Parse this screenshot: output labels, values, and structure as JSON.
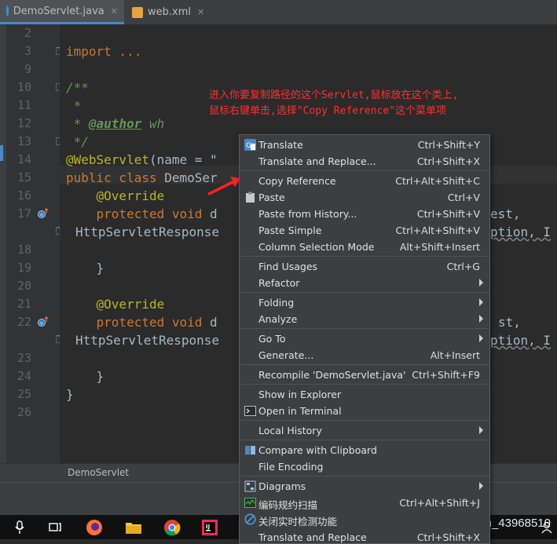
{
  "tabs": [
    {
      "label": "DemoServlet.java",
      "active": true,
      "icon": "java-class-icon"
    },
    {
      "label": "web.xml",
      "active": false,
      "icon": "xml-file-icon"
    }
  ],
  "gutter": {
    "line_numbers": [
      "2",
      "3",
      "9",
      "10",
      "11",
      "12",
      "13",
      "14",
      "15",
      "16",
      "17",
      "",
      "18",
      "19",
      "20",
      "21",
      "22",
      "",
      "23",
      "24",
      "25",
      "26"
    ]
  },
  "code": {
    "l3": "import ...",
    "l10": "/**",
    "l11": " *",
    "l12_star": " * ",
    "l12_tag": "@author",
    "l12_rest": " wh",
    "l13": " */",
    "l14_ann": "@WebServlet",
    "l14_rest": "(name = \"",
    "l15_kw": "public class ",
    "l15_rest": "DemoSer",
    "l16": "    @Override",
    "l17_kw": "    protected void ",
    "l17_rest": "d",
    "l17_right": "est,",
    "l17b": "HttpServletResponse",
    "l17b_right": "ption, I",
    "l19": "    }",
    "l21": "    @Override",
    "l22_kw": "    protected void ",
    "l22_rest": "d",
    "l22_right": "st,",
    "l22b": "HttpServletResponse",
    "l22b_right": "ption, I",
    "l24": "    }",
    "l25": "}"
  },
  "annotation_note": "进入你要复制路径的这个Servlet,鼠标放在这个类上,\n鼠标右键单击,选择\"Copy Reference\"这个菜单项",
  "breadcrumb": "DemoServlet",
  "watermark": "https://blog.csdn.net/weixin_43968510",
  "menu": {
    "items": [
      {
        "label": "Translate",
        "shortcut": "Ctrl+Shift+Y",
        "icon": "translate-icon"
      },
      {
        "label": "Translate and Replace...",
        "shortcut": "Ctrl+Shift+X"
      },
      {
        "label": "Copy Reference",
        "shortcut": "Ctrl+Alt+Shift+C"
      },
      {
        "label": "Paste",
        "shortcut": "Ctrl+V",
        "icon": "clipboard-icon"
      },
      {
        "label": "Paste from History...",
        "shortcut": "Ctrl+Shift+V"
      },
      {
        "label": "Paste Simple",
        "shortcut": "Ctrl+Alt+Shift+V"
      },
      {
        "label": "Column Selection Mode",
        "shortcut": "Alt+Shift+Insert"
      },
      {
        "label": "Find Usages",
        "shortcut": "Ctrl+G"
      },
      {
        "label": "Refactor",
        "shortcut": ""
      },
      {
        "label": "Folding",
        "shortcut": ""
      },
      {
        "label": "Analyze",
        "shortcut": ""
      },
      {
        "label": "Go To",
        "shortcut": ""
      },
      {
        "label": "Generate...",
        "shortcut": "Alt+Insert"
      },
      {
        "label": "Recompile 'DemoServlet.java'",
        "shortcut": "Ctrl+Shift+F9"
      },
      {
        "label": "Show in Explorer",
        "shortcut": ""
      },
      {
        "label": "Open in Terminal",
        "shortcut": "",
        "icon": "terminal-icon"
      },
      {
        "label": "Local History",
        "shortcut": ""
      },
      {
        "label": "Compare with Clipboard",
        "shortcut": "",
        "icon": "compare-icon"
      },
      {
        "label": "File Encoding",
        "shortcut": ""
      },
      {
        "label": "Diagrams",
        "shortcut": "",
        "icon": "diagram-icon"
      },
      {
        "label": "编码规约扫描",
        "shortcut": "Ctrl+Alt+Shift+J",
        "icon": "scan-icon"
      },
      {
        "label": "关闭实时检测功能",
        "shortcut": "",
        "icon": "disable-icon"
      },
      {
        "label": "Translate and Replace",
        "shortcut": "Ctrl+Shift+X"
      }
    ]
  },
  "colors": {
    "editor_bg": "#2b2b2b",
    "menu_bg": "#3c3f41",
    "keyword": "#cc7832",
    "annotation": "#bbb529",
    "comment": "#629755",
    "note_red": "#ff3030"
  }
}
